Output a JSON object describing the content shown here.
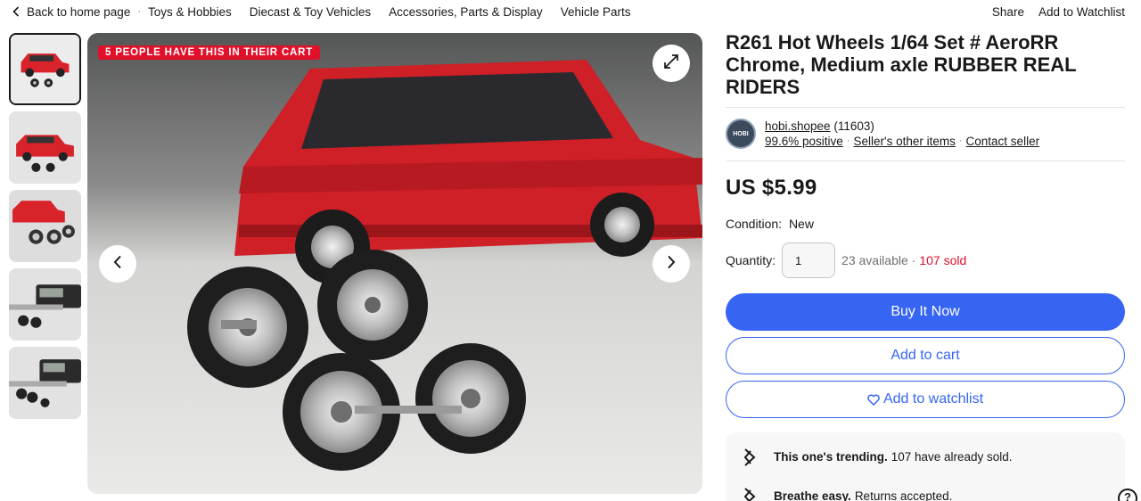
{
  "breadcrumb": {
    "back": "Back to home page",
    "categories": [
      "Toys & Hobbies",
      "Diecast & Toy Vehicles",
      "Accessories, Parts & Display",
      "Vehicle Parts"
    ]
  },
  "top_actions": {
    "share": "Share",
    "watchlist": "Add to Watchlist"
  },
  "gallery": {
    "badge": "5 people have this in their cart",
    "thumbnail_count": 5,
    "active_index": 0
  },
  "listing": {
    "title": "R261 Hot Wheels 1/64 Set # AeroRR Chrome, Medium axle RUBBER REAL RIDERS",
    "price": "US $5.99",
    "condition_label": "Condition:",
    "condition_value": "New",
    "quantity_label": "Quantity:",
    "quantity_value": "1",
    "available": "23 available",
    "sold": "107 sold"
  },
  "seller": {
    "name": "hobi.shopee",
    "feedback_count": "(11603)",
    "positive": "99.6% positive",
    "other_items": "Seller's other items",
    "contact": "Contact seller"
  },
  "buttons": {
    "buy_now": "Buy It Now",
    "add_to_cart": "Add to cart",
    "add_to_watchlist": "Add to watchlist"
  },
  "highlights": [
    {
      "bold": "This one's trending.",
      "text": "107 have already sold.",
      "icon": "trending-icon"
    },
    {
      "bold": "Breathe easy.",
      "text": "Returns accepted.",
      "icon": "returns-icon"
    }
  ],
  "colors": {
    "accent": "#3665f3",
    "badge": "#e0102a",
    "car_red": "#d8232a"
  }
}
